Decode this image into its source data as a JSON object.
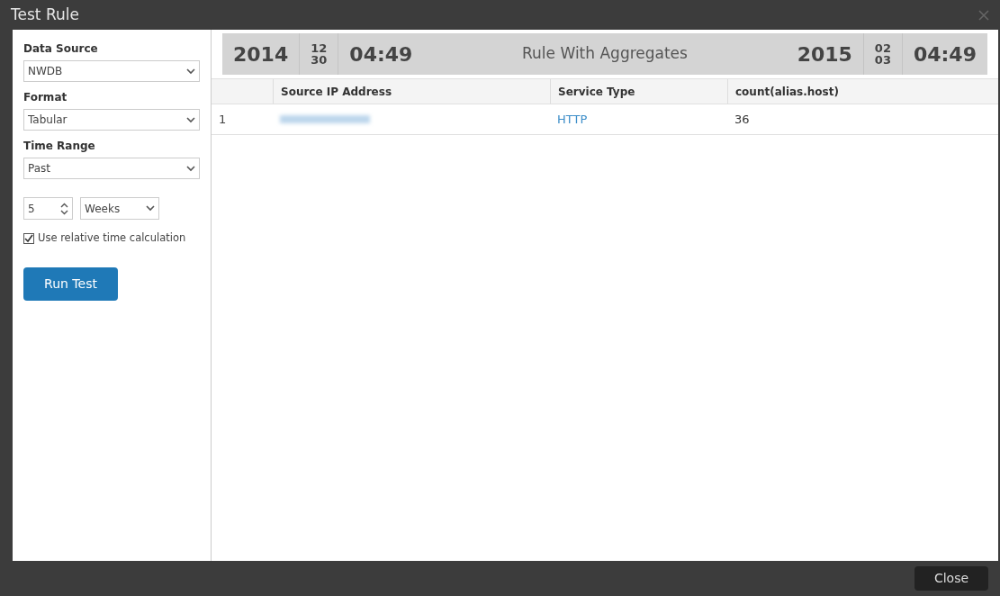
{
  "window": {
    "title": "Test Rule"
  },
  "sidebar": {
    "fields": [
      {
        "kind": "select",
        "label": "Data Source",
        "value": "NWDB"
      },
      {
        "kind": "select",
        "label": "Format",
        "value": "Tabular"
      },
      {
        "kind": "select",
        "label": "Time Range",
        "value": "Past"
      }
    ],
    "amount": "5",
    "unit": "Weeks",
    "relative_time": {
      "label": "Use relative time calculation",
      "checked": true
    },
    "run_button": "Run Test"
  },
  "timeline": {
    "start": {
      "year": "2014",
      "month": "12",
      "day": "30",
      "time": "04:49"
    },
    "title": "Rule With Aggregates",
    "end": {
      "year": "2015",
      "month": "02",
      "day": "03",
      "time": "04:49"
    }
  },
  "table": {
    "columns": [
      "",
      "Source IP Address",
      "Service Type",
      "count(alias.host)"
    ],
    "rows": [
      {
        "index": "1",
        "service": "HTTP",
        "count": "36"
      }
    ]
  },
  "footer": {
    "close_button": "Close"
  }
}
